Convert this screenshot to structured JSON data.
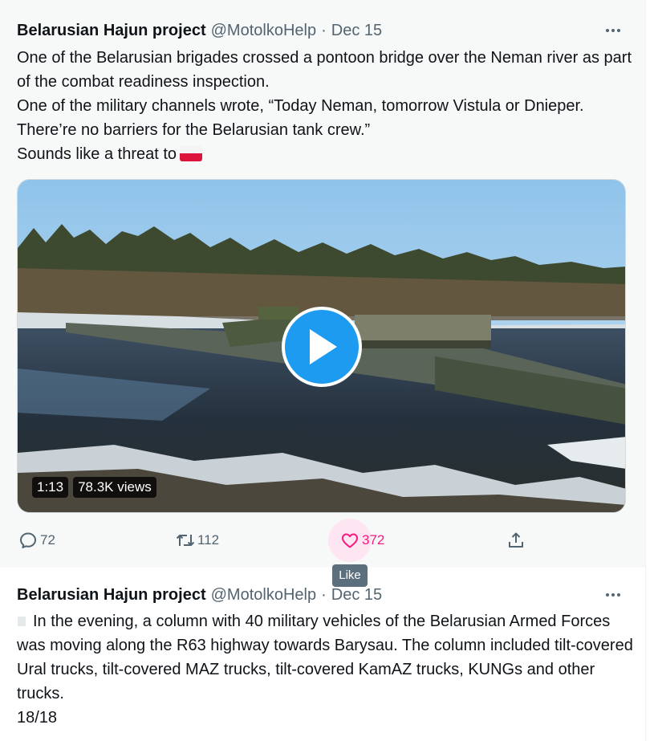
{
  "tweets": [
    {
      "author_name": "Belarusian Hajun project",
      "handle": "@MotolkoHelp",
      "separator": "·",
      "date": "Dec 15",
      "lines": [
        "One of the Belarusian brigades crossed a pontoon bridge over the Neman river as part of the combat readiness inspection.",
        "One of the military channels wrote, “Today Neman, tomorrow Vistula or Dnieper. There’re no barriers for the Belarusian tank crew.”",
        "Sounds like a threat to"
      ],
      "flag_icon": "poland-flag-emoji",
      "video": {
        "duration": "1:13",
        "views": "78.3K views",
        "play_icon": "play-icon"
      },
      "actions": {
        "reply_count": "72",
        "retweet_count": "112",
        "like_count": "372",
        "reply_icon": "reply-icon",
        "retweet_icon": "retweet-icon",
        "like_icon": "heart-icon",
        "share_icon": "share-icon"
      },
      "tooltip": "Like"
    },
    {
      "author_name": "Belarusian Hajun project",
      "handle": "@MotolkoHelp",
      "separator": "·",
      "date": "Dec 15",
      "text": "In the evening, a column with 40 military vehicles of the Belarusian Armed Forces was moving along the R63 highway towards Barysau. The column included tilt-covered Ural trucks, tilt-covered MAZ trucks, tilt-covered KamAZ trucks, KUNGs and other trucks.",
      "thread_index": "18/18"
    }
  ],
  "colors": {
    "accent": "#1d9bf0",
    "like": "#f91880",
    "secondary_text": "#536471",
    "hover_bg": "#f7f9f9"
  }
}
